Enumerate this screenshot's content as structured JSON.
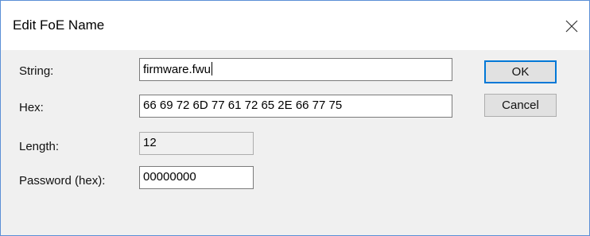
{
  "window": {
    "title": "Edit FoE Name"
  },
  "form": {
    "string_label": "String:",
    "string_value": "firmware.fwu",
    "hex_label": "Hex:",
    "hex_value": "66 69 72 6D 77 61 72 65 2E 66 77 75",
    "length_label": "Length:",
    "length_value": "12",
    "password_label": "Password (hex):",
    "password_value": "00000000"
  },
  "buttons": {
    "ok_label": "OK",
    "cancel_label": "Cancel"
  },
  "icons": {
    "close": "close-icon"
  }
}
